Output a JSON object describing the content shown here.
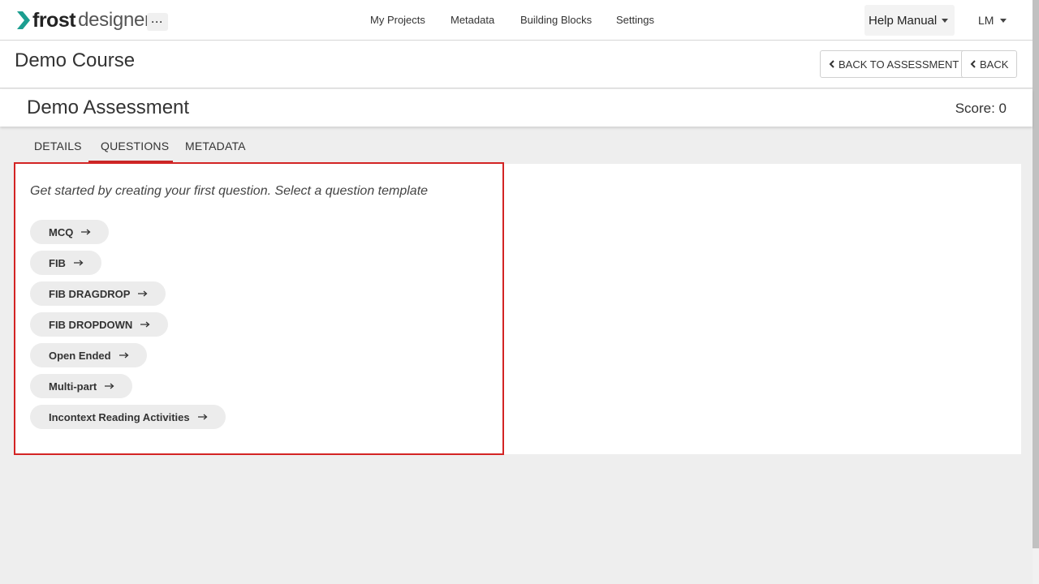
{
  "brand": {
    "name_bold": "frost",
    "name_light": "designer",
    "accent": "#1b9e90"
  },
  "nav": {
    "more_label": "···",
    "links": [
      "My Projects",
      "Metadata",
      "Building Blocks",
      "Settings"
    ],
    "help_label": "Help Manual",
    "user_initials": "LM"
  },
  "course": {
    "title": "Demo Course",
    "back_to_assessment_label": "BACK TO ASSESSMENT",
    "back_label": "BACK"
  },
  "assessment": {
    "title": "Demo Assessment",
    "score_text": "Score: 0"
  },
  "tabs": [
    {
      "label": "DETAILS",
      "active": false
    },
    {
      "label": "QUESTIONS",
      "active": true
    },
    {
      "label": "METADATA",
      "active": false
    }
  ],
  "questions": {
    "intro": "Get started by creating your first question. Select a question template",
    "templates": [
      "MCQ",
      "FIB",
      "FIB DRAGDROP",
      "FIB DROPDOWN",
      "Open Ended",
      "Multi-part",
      "Incontext Reading Activities"
    ]
  },
  "colors": {
    "highlight": "#d32424",
    "tab_active": "#c62828"
  }
}
